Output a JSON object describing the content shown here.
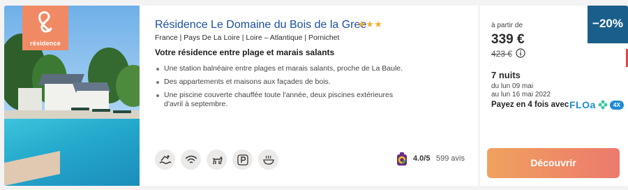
{
  "listing": {
    "logo_text": "résidence",
    "title": "Résidence Le Domaine du Bois de la Gree",
    "stars": "★★★",
    "location": "France | Pays De La Loire | Loire – Atlantique | Pornichet",
    "subtitle": "Votre résidence entre plage et marais salants",
    "bullets": [
      "Une station balnéaire entre plages et marais salants, proche de La Baule.",
      "Des appartements et maisons aux façades de bois.",
      "Une piscine couverte chauffée toute l'année, deux piscines extérieures d'avril à septembre."
    ],
    "amenities": [
      "pool-icon",
      "wifi-icon",
      "pet-icon",
      "parking-icon",
      "spa-icon"
    ],
    "rating": "4.0/5",
    "reviews": "599 avis"
  },
  "pricing": {
    "from_label": "à partir de",
    "price": "339 €",
    "old_price": "423 €",
    "discount": "−20%",
    "nights": "7 nuits",
    "date_from": "du lun 09 mai",
    "date_to": "au lun 16 mai 2022",
    "installment_text": "Payez en 4 fois avec",
    "floa_logo": "FLOa",
    "floa_badge": "4X",
    "cta": "Découvrir"
  },
  "colors": {
    "title": "#1c4fa3",
    "stars": "#f2b02c",
    "discount_bg": "#1a5f8b",
    "cta_start": "#f0a25f",
    "cta_end": "#ec7a6d",
    "logo_bg": "#f08a64"
  }
}
